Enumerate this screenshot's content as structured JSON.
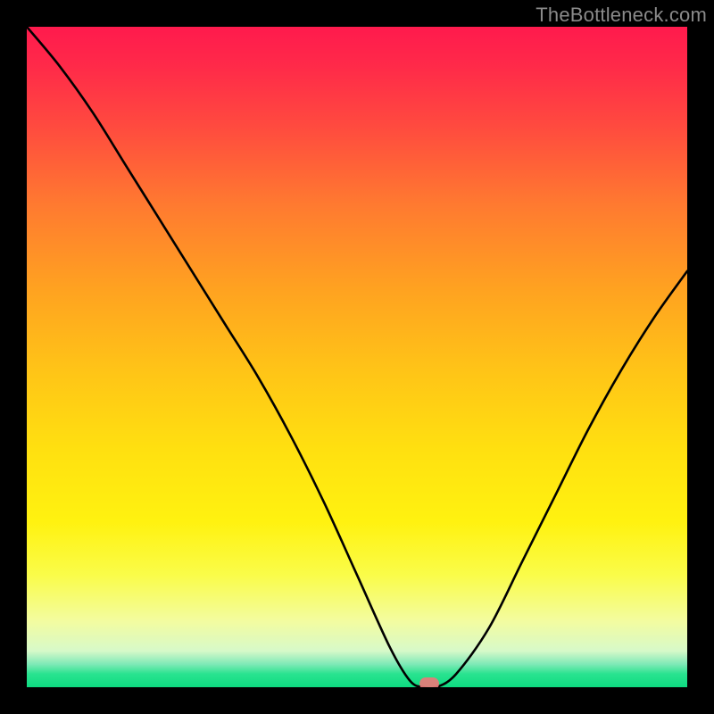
{
  "watermark": "TheBottleneck.com",
  "chart_data": {
    "type": "line",
    "title": "",
    "xlabel": "",
    "ylabel": "",
    "x": [
      0,
      5,
      10,
      15,
      20,
      25,
      30,
      35,
      40,
      45,
      50,
      55,
      58,
      60,
      62,
      65,
      70,
      75,
      80,
      85,
      90,
      95,
      100
    ],
    "values": [
      100,
      94,
      87,
      79,
      71,
      63,
      55,
      47,
      38,
      28,
      17,
      6,
      1,
      0,
      0,
      2,
      9,
      19,
      29,
      39,
      48,
      56,
      63
    ],
    "xlim": [
      0,
      100
    ],
    "ylim": [
      0,
      100
    ],
    "marker": {
      "x": 61,
      "y": 0
    },
    "gradient_stops": [
      {
        "pos": 0,
        "color": "#ff1a4d"
      },
      {
        "pos": 15,
        "color": "#ff4a3f"
      },
      {
        "pos": 40,
        "color": "#ffa320"
      },
      {
        "pos": 64,
        "color": "#ffe010"
      },
      {
        "pos": 83,
        "color": "#fafc49"
      },
      {
        "pos": 96,
        "color": "#7fe9b7"
      },
      {
        "pos": 100,
        "color": "#0edb81"
      }
    ]
  }
}
